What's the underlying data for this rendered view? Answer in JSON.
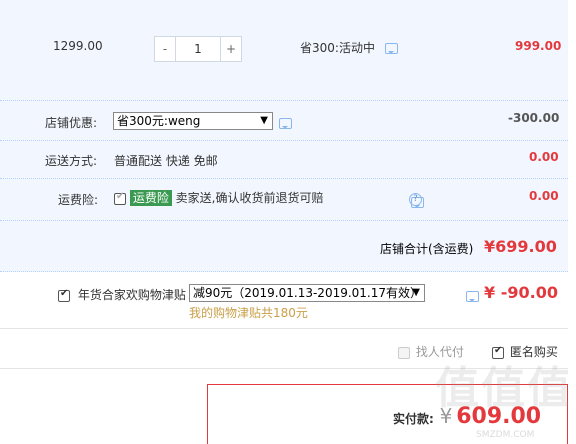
{
  "item": {
    "unit_price": "1299.00",
    "quantity": "1",
    "minus": "-",
    "plus": "+",
    "promo": "省300:活动中",
    "subtotal": "999.00"
  },
  "shop_discount": {
    "label": "店铺优惠:",
    "selected": "省300元:weng",
    "amount": "-300.00"
  },
  "shipping": {
    "label": "运送方式:",
    "value": "普通配送 快递 免邮",
    "amount": "0.00"
  },
  "insurance": {
    "label": "运费险:",
    "tag": "运费险",
    "text": "卖家送,确认收货前退货可赔",
    "help": "?",
    "amount": "0.00"
  },
  "shop_total": {
    "label": "店铺合计(含运费)",
    "amount": "¥699.00"
  },
  "allowance": {
    "label": "年货合家欢购物津贴",
    "selected": "减90元（2019.01.13-2019.01.17有效）",
    "note": "我的购物津贴共180元",
    "amount": "¥ -90.00"
  },
  "options": {
    "proxy_pay": "找人代付",
    "anonymous": "匿名购买"
  },
  "payment": {
    "label": "实付款:",
    "currency": "¥",
    "amount": "609.00"
  },
  "watermark": {
    "text": "值值值",
    "sub": "SMZDM.COM"
  }
}
